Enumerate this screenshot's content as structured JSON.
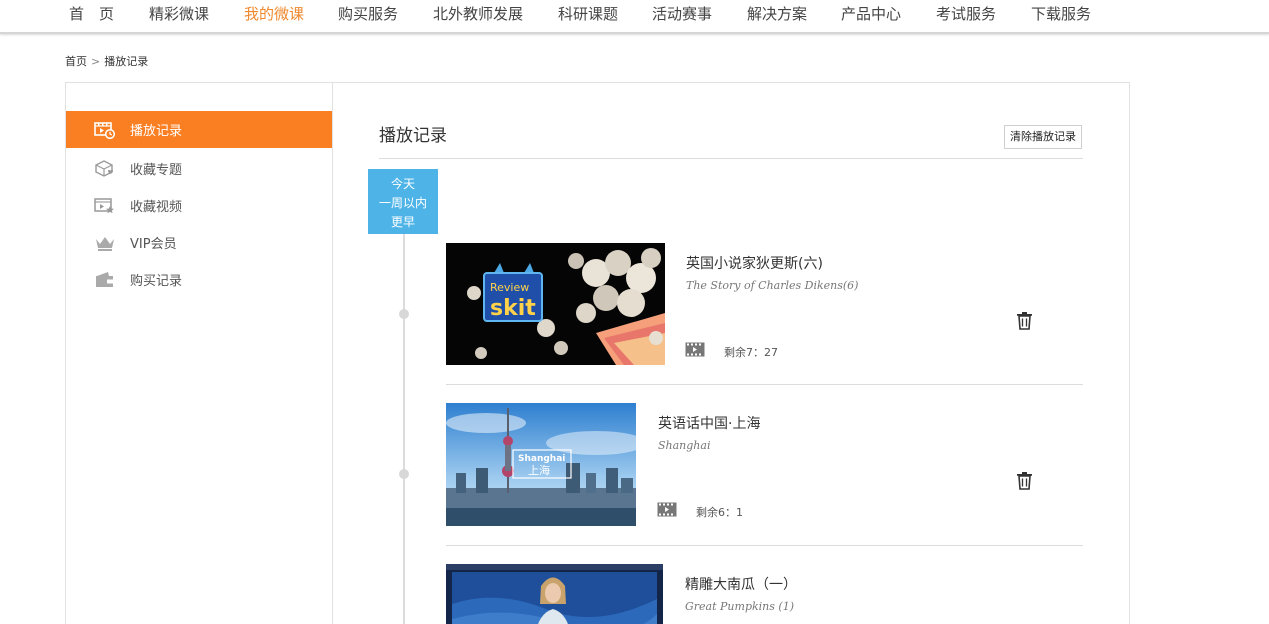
{
  "nav": {
    "items": [
      {
        "label": "首　页",
        "active": false
      },
      {
        "label": "精彩微课",
        "active": false
      },
      {
        "label": "我的微课",
        "active": true
      },
      {
        "label": "购买服务",
        "active": false
      },
      {
        "label": "北外教师发展",
        "active": false
      },
      {
        "label": "科研课题",
        "active": false
      },
      {
        "label": "活动赛事",
        "active": false
      },
      {
        "label": "解决方案",
        "active": false
      },
      {
        "label": "产品中心",
        "active": false
      },
      {
        "label": "考试服务",
        "active": false
      },
      {
        "label": "下载服务",
        "active": false
      }
    ]
  },
  "breadcrumb": {
    "home": "首页",
    "separator": ">",
    "current": "播放记录"
  },
  "sidebar": {
    "items": [
      {
        "label": "播放记录",
        "icon": "play-history-icon",
        "active": true
      },
      {
        "label": "收藏专题",
        "icon": "favorite-topic-icon",
        "active": false
      },
      {
        "label": "收藏视频",
        "icon": "favorite-video-icon",
        "active": false
      },
      {
        "label": "VIP会员",
        "icon": "crown-icon",
        "active": false
      },
      {
        "label": "购买记录",
        "icon": "wallet-icon",
        "active": false
      }
    ]
  },
  "main": {
    "title": "播放记录",
    "clear_label": "清除播放记录",
    "filters": [
      "今天",
      "一周以内",
      "更早"
    ],
    "entries": [
      {
        "title": "英国小说家狄更斯(六)",
        "subtitle": "The Story of Charles Dikens(6)",
        "remaining": "剩余7：27",
        "thumb_text_1": "Review",
        "thumb_text_2": "skit"
      },
      {
        "title": "英语话中国·上海",
        "subtitle": "Shanghai",
        "remaining": "剩余6：1",
        "thumb_text_1": "Shanghai",
        "thumb_text_2": "上海"
      },
      {
        "title": "精雕大南瓜（一）",
        "subtitle": "Great Pumpkins (1)"
      }
    ]
  },
  "colors": {
    "accent": "#f97f22",
    "nav_active": "#f0892e",
    "filter_bg": "#4eb4e8"
  }
}
